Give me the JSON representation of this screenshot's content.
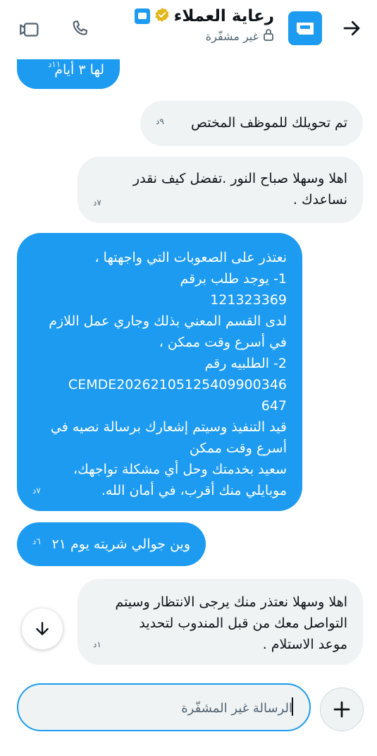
{
  "header": {
    "title": "رعاية العملاء",
    "subtitle": "غير مشفّرة",
    "verified_badge": "verified-badge-icon",
    "brand_color": "#1d9bf0"
  },
  "messages": [
    {
      "dir": "out",
      "text": "لها ٣ أيام",
      "time": "١١د"
    },
    {
      "dir": "in",
      "text": "تم تحويلك للموظف المختص",
      "time": "٩د"
    },
    {
      "dir": "in",
      "text": "اهلا وسهلا صباح النور .تفضل كيف نقدر\nنساعدك .",
      "time": "٧د"
    },
    {
      "dir": "out",
      "text": "نعتذر على الصعوبات التي واجهتها ،\n1- يوجد طلب برقم\n121323369\nلدى القسم المعني بذلك وجاري عمل اللازم\nفي أسرع وقت ممكن ،\n2- الطلبيه رقم\nCEMDE2026210512540990034‎6\n647\nقيد التنفيذ وسيتم إشعارك برسالة نصيه في\nأسرع وقت ممكن\nسعيد بخدمتك وحل أي مشكلة تواجهك،\nموبايلي منك أقرب، في أمان الله.",
      "time": "٧د"
    },
    {
      "dir": "out",
      "text": "وين جوالي شريته يوم ٢١",
      "time": "٦د"
    },
    {
      "dir": "in",
      "text": "اهلا وسهلا نعتذر منك يرجى الانتظار وسيتم\nالتواصل معك من قبل المندوب لتحديد\nموعد الاستلام .",
      "time": "١د"
    }
  ],
  "composer": {
    "placeholder": "الرسالة غير المشفّرة"
  }
}
